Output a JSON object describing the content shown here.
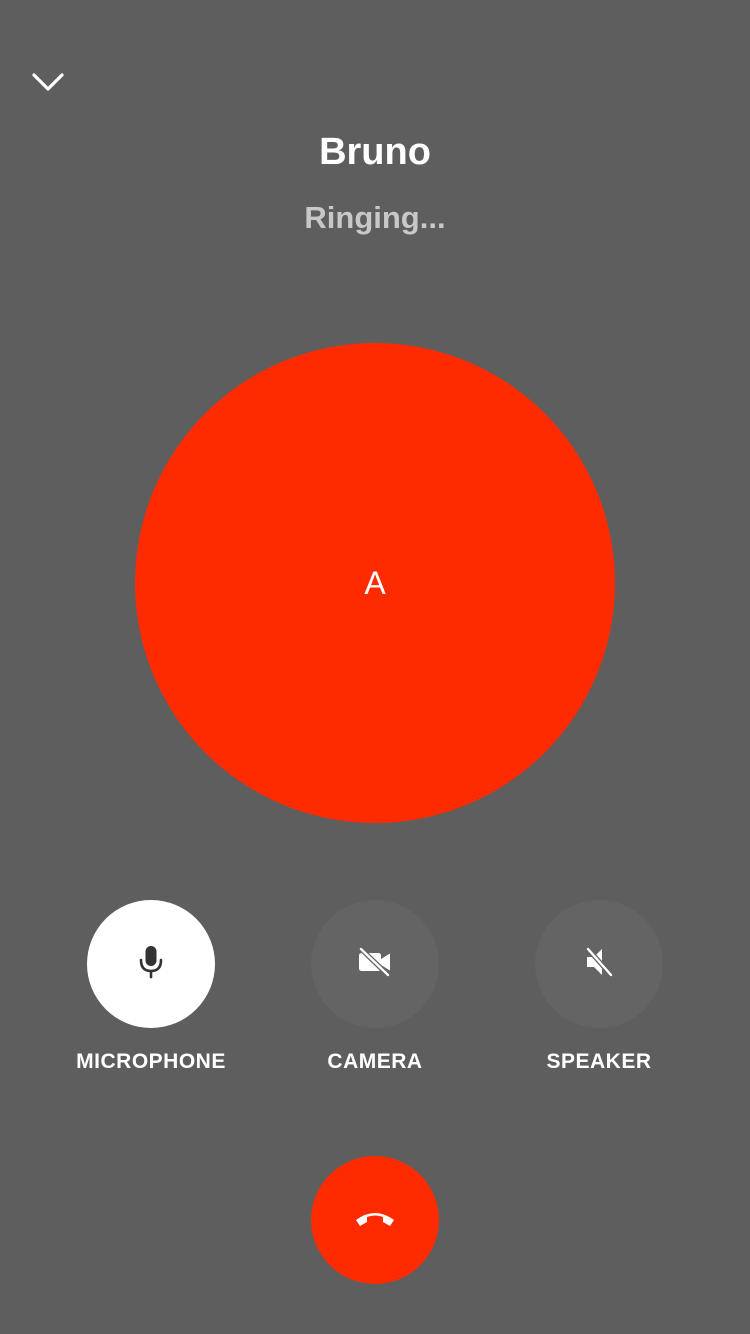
{
  "caller": {
    "name": "Bruno",
    "status": "Ringing...",
    "avatar_initial": "A"
  },
  "controls": [
    {
      "label": "MICROPHONE",
      "icon": "microphone-icon",
      "active": true
    },
    {
      "label": "CAMERA",
      "icon": "camera-off-icon",
      "active": false
    },
    {
      "label": "SPEAKER",
      "icon": "speaker-off-icon",
      "active": false
    }
  ],
  "icons": {
    "collapse": "chevron-down-icon",
    "hangup": "phone-hangup-icon"
  },
  "colors": {
    "background": "#5e5e5e",
    "accent": "#ff2b00",
    "control_off": "#646464",
    "control_on": "#ffffff"
  }
}
